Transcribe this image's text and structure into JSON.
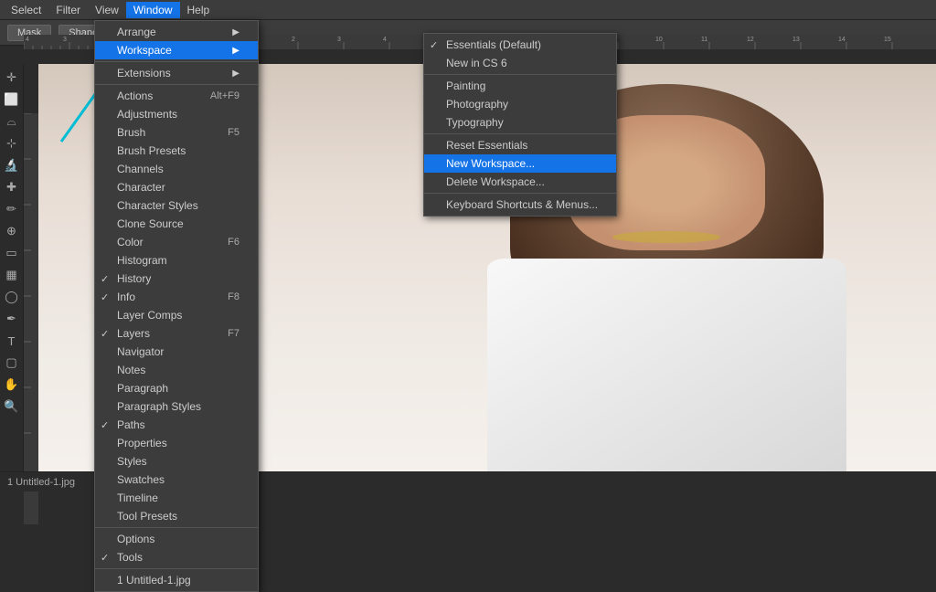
{
  "menubar": {
    "items": [
      {
        "label": "Select",
        "id": "select"
      },
      {
        "label": "Filter",
        "id": "filter"
      },
      {
        "label": "View",
        "id": "view"
      },
      {
        "label": "Window",
        "id": "window",
        "active": true
      },
      {
        "label": "Help",
        "id": "help"
      }
    ]
  },
  "optionsbar": {
    "mask_label": "Mask",
    "shape_label": "Shape"
  },
  "window_menu": {
    "items": [
      {
        "label": "Arrange",
        "has_arrow": true,
        "id": "arrange"
      },
      {
        "label": "Workspace",
        "has_arrow": true,
        "id": "workspace",
        "active": true
      },
      {
        "id": "sep1",
        "separator": true
      },
      {
        "label": "Extensions",
        "has_arrow": true,
        "id": "extensions"
      },
      {
        "id": "sep2",
        "separator": true
      },
      {
        "label": "Actions",
        "shortcut": "Alt+F9",
        "id": "actions"
      },
      {
        "label": "Adjustments",
        "id": "adjustments"
      },
      {
        "label": "Brush",
        "shortcut": "F5",
        "id": "brush"
      },
      {
        "label": "Brush Presets",
        "id": "brush-presets"
      },
      {
        "label": "Channels",
        "id": "channels"
      },
      {
        "label": "Character",
        "id": "character"
      },
      {
        "label": "Character Styles",
        "id": "character-styles"
      },
      {
        "label": "Clone Source",
        "id": "clone-source"
      },
      {
        "label": "Color",
        "shortcut": "F6",
        "id": "color"
      },
      {
        "label": "Histogram",
        "id": "histogram"
      },
      {
        "label": "History",
        "checked": true,
        "id": "history"
      },
      {
        "label": "Info",
        "shortcut": "F8",
        "checked": true,
        "id": "info"
      },
      {
        "label": "Layer Comps",
        "id": "layer-comps"
      },
      {
        "label": "Layers",
        "shortcut": "F7",
        "checked": true,
        "id": "layers"
      },
      {
        "label": "Navigator",
        "id": "navigator"
      },
      {
        "label": "Notes",
        "id": "notes"
      },
      {
        "label": "Paragraph",
        "id": "paragraph"
      },
      {
        "label": "Paragraph Styles",
        "id": "paragraph-styles"
      },
      {
        "label": "Paths",
        "checked": true,
        "id": "paths"
      },
      {
        "label": "Properties",
        "id": "properties"
      },
      {
        "label": "Styles",
        "id": "styles"
      },
      {
        "label": "Swatches",
        "id": "swatches"
      },
      {
        "label": "Timeline",
        "id": "timeline"
      },
      {
        "label": "Tool Presets",
        "id": "tool-presets"
      },
      {
        "id": "sep3",
        "separator": true
      },
      {
        "label": "Options",
        "id": "options"
      },
      {
        "label": "Tools",
        "checked": true,
        "id": "tools"
      },
      {
        "id": "sep4",
        "separator": true
      },
      {
        "label": "1 Untitled-1.jpg",
        "id": "file1"
      }
    ]
  },
  "workspace_menu": {
    "items": [
      {
        "label": "Essentials (Default)",
        "checked": true,
        "id": "essentials"
      },
      {
        "label": "New in CS 6",
        "id": "new-cs6"
      },
      {
        "id": "sep1",
        "separator": true
      },
      {
        "label": "Painting",
        "id": "painting"
      },
      {
        "label": "Photography",
        "id": "photography"
      },
      {
        "label": "Typography",
        "id": "typography"
      },
      {
        "id": "sep2",
        "separator": true
      },
      {
        "label": "Reset Essentials",
        "id": "reset-essentials"
      },
      {
        "label": "New Workspace...",
        "id": "new-workspace",
        "active": true
      },
      {
        "label": "Delete Workspace...",
        "id": "delete-workspace"
      },
      {
        "id": "sep3",
        "separator": true
      },
      {
        "label": "Keyboard Shortcuts & Menus...",
        "id": "keyboard-shortcuts"
      }
    ]
  },
  "statusbar": {
    "document": "1 Untitled-1.jpg"
  },
  "colors": {
    "active_bg": "#1473e6",
    "menu_bg": "#3c3c3c",
    "hover_bg": "#1473e6"
  }
}
